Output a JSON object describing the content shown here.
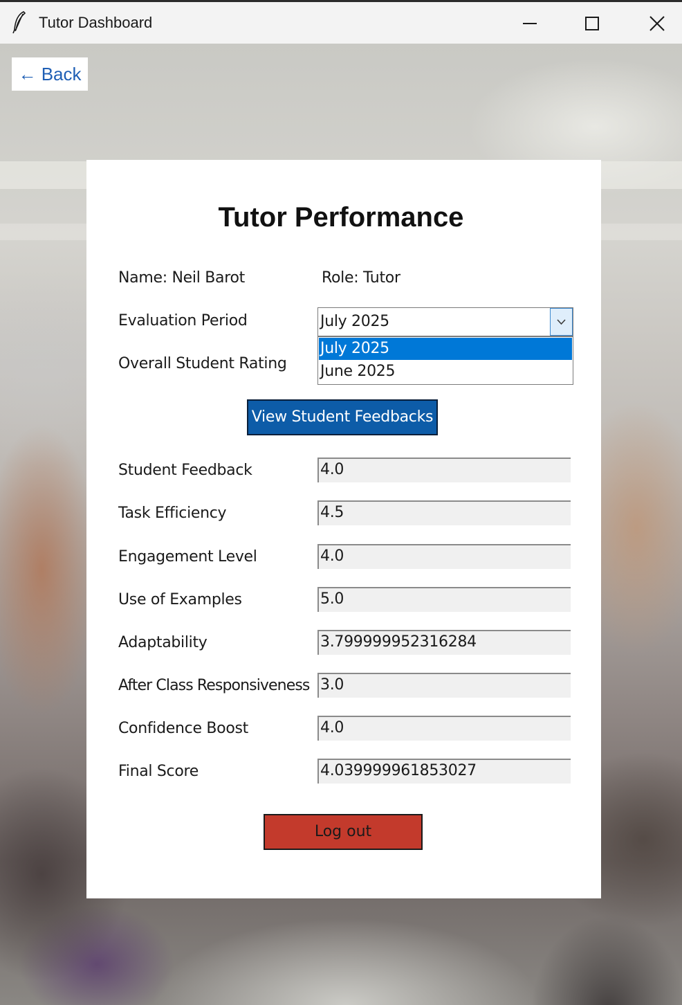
{
  "window": {
    "title": "Tutor Dashboard",
    "minimize_icon": "minimize-icon",
    "maximize_icon": "maximize-icon",
    "close_icon": "close-icon",
    "app_icon": "feather-icon"
  },
  "nav": {
    "back_label": "← Back"
  },
  "card": {
    "title": "Tutor Performance",
    "name_label": "Name: Neil Barot",
    "role_label": "Role: Tutor",
    "evaluation_period_label": "Evaluation Period",
    "evaluation_period_value": "July 2025",
    "evaluation_period_options": [
      "July 2025",
      "June 2025"
    ],
    "evaluation_period_selected_index": 0,
    "overall_rating_label": "Overall Student Rating",
    "view_feedbacks_label": "View Student Feedbacks",
    "metrics": [
      {
        "label": "Student Feedback",
        "value": "4.0"
      },
      {
        "label": "Task Efficiency",
        "value": "4.5"
      },
      {
        "label": "Engagement Level",
        "value": "4.0"
      },
      {
        "label": "Use of Examples",
        "value": "5.0"
      },
      {
        "label": "Adaptability",
        "value": "3.799999952316284"
      },
      {
        "label": "After Class Responsiveness",
        "value": "3.0"
      },
      {
        "label": "Confidence Boost",
        "value": "4.0"
      },
      {
        "label": "Final Score",
        "value": "4.039999961853027"
      }
    ],
    "logout_label": "Log out"
  },
  "colors": {
    "back_text": "#1f5fb5",
    "feedback_button": "#0d5ca8",
    "logout_button": "#c33a2c",
    "selected_option": "#0078d7"
  }
}
